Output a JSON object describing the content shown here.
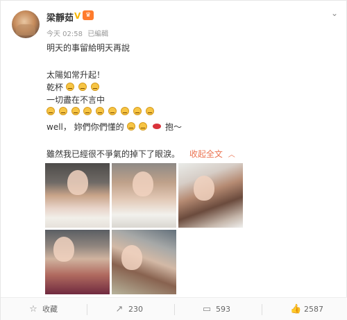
{
  "post": {
    "username": "梁靜茹",
    "verified_badge": "V",
    "crown_badge": "♛",
    "time": "今天 02:58",
    "edited": "已編輯",
    "lines": [
      "明天的事留給明天再說",
      "太陽如常升起！",
      "乾杯",
      "一切盡在不言中",
      "well，  妳們你們懂的",
      "抱～",
      "雖然我已經很不爭氣的掉下了眼淚。"
    ],
    "collapse_label": "收起全文",
    "collapse_icon": "chevron-up-icon"
  },
  "actions": {
    "favorite_label": "收藏",
    "repost_count": "230",
    "comment_count": "593",
    "like_count": "2587"
  },
  "icons": {
    "menu": "chevron-down-icon",
    "favorite": "star-icon",
    "repost": "share-icon",
    "comment": "comment-icon",
    "like": "thumbs-up-icon"
  },
  "colors": {
    "accent": "#eb7350",
    "verified": "#f7b500"
  }
}
